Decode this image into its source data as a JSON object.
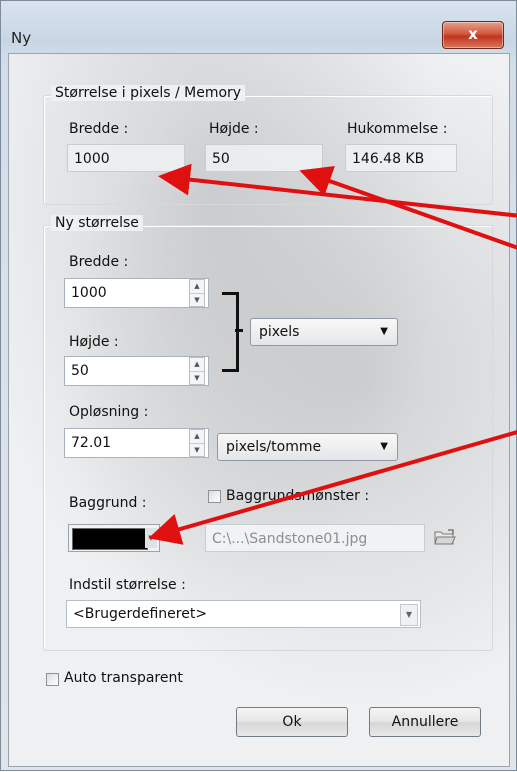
{
  "window": {
    "title": "Ny",
    "close_label": "x"
  },
  "size_pixels_group": {
    "label": "Størrelse i pixels / Memory",
    "width_label": "Bredde :",
    "width_value": "1000",
    "height_label": "Højde :",
    "height_value": "50",
    "memory_label": "Hukommelse :",
    "memory_value": "146.48 KB"
  },
  "new_size_group": {
    "label": "Ny størrelse",
    "width_label": "Bredde :",
    "width_value": "1000",
    "height_label": "Højde :",
    "height_value": "50",
    "unit_selected": "pixels",
    "resolution_label": "Opløsning :",
    "resolution_value": "72.01",
    "resolution_unit": "pixels/tomme",
    "background_label": "Baggrund :",
    "background_color": "#000000",
    "pattern_label": "Baggrundsmønster :",
    "pattern_value": "C:\\...\\Sandstone01.jpg",
    "preset_label": "Indstil størrelse :",
    "preset_value": "<Brugerdefineret>"
  },
  "auto_transparent_label": "Auto transparent",
  "buttons": {
    "ok": "Ok",
    "cancel": "Annullere"
  },
  "annotation_color": "#e01010"
}
